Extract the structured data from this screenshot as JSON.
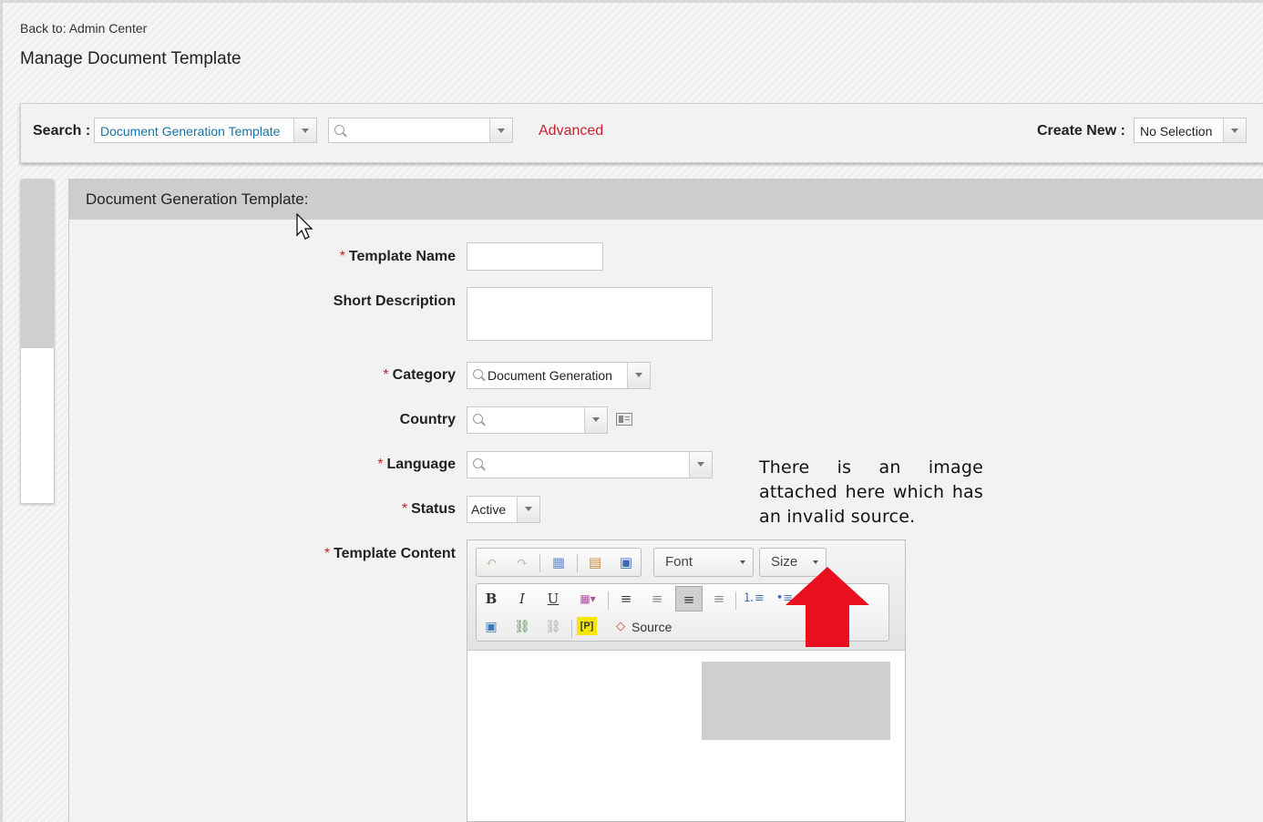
{
  "nav": {
    "back_link": "Back to: Admin Center"
  },
  "page": {
    "title": "Manage Document Template"
  },
  "search": {
    "label": "Search :",
    "type_value": "Document Generation Template",
    "query_value": "",
    "advanced_label": "Advanced",
    "create_new_label": "Create New :",
    "create_new_value": "No Selection"
  },
  "panel": {
    "header": "Document Generation Template:"
  },
  "form": {
    "required_mark": "*",
    "template_name": {
      "label": "Template Name",
      "value": ""
    },
    "short_description": {
      "label": "Short Description",
      "value": ""
    },
    "category": {
      "label": "Category",
      "value": "Document Generation"
    },
    "country": {
      "label": "Country",
      "value": ""
    },
    "language": {
      "label": "Language",
      "value": ""
    },
    "status": {
      "label": "Status",
      "value": "Active"
    },
    "template_content": {
      "label": "Template Content"
    }
  },
  "editor": {
    "font_label": "Font",
    "size_label": "Size",
    "bold": "B",
    "italic": "I",
    "underline": "U",
    "placeholder_btn": "[P]",
    "source_label": "Source"
  },
  "annotation": {
    "text": "There is an image attached here which has an invalid source.",
    "arrow_color": "#e8101e"
  },
  "colors": {
    "required": "#c8202f",
    "link": "#1a73a8",
    "advanced": "#c8202f"
  }
}
